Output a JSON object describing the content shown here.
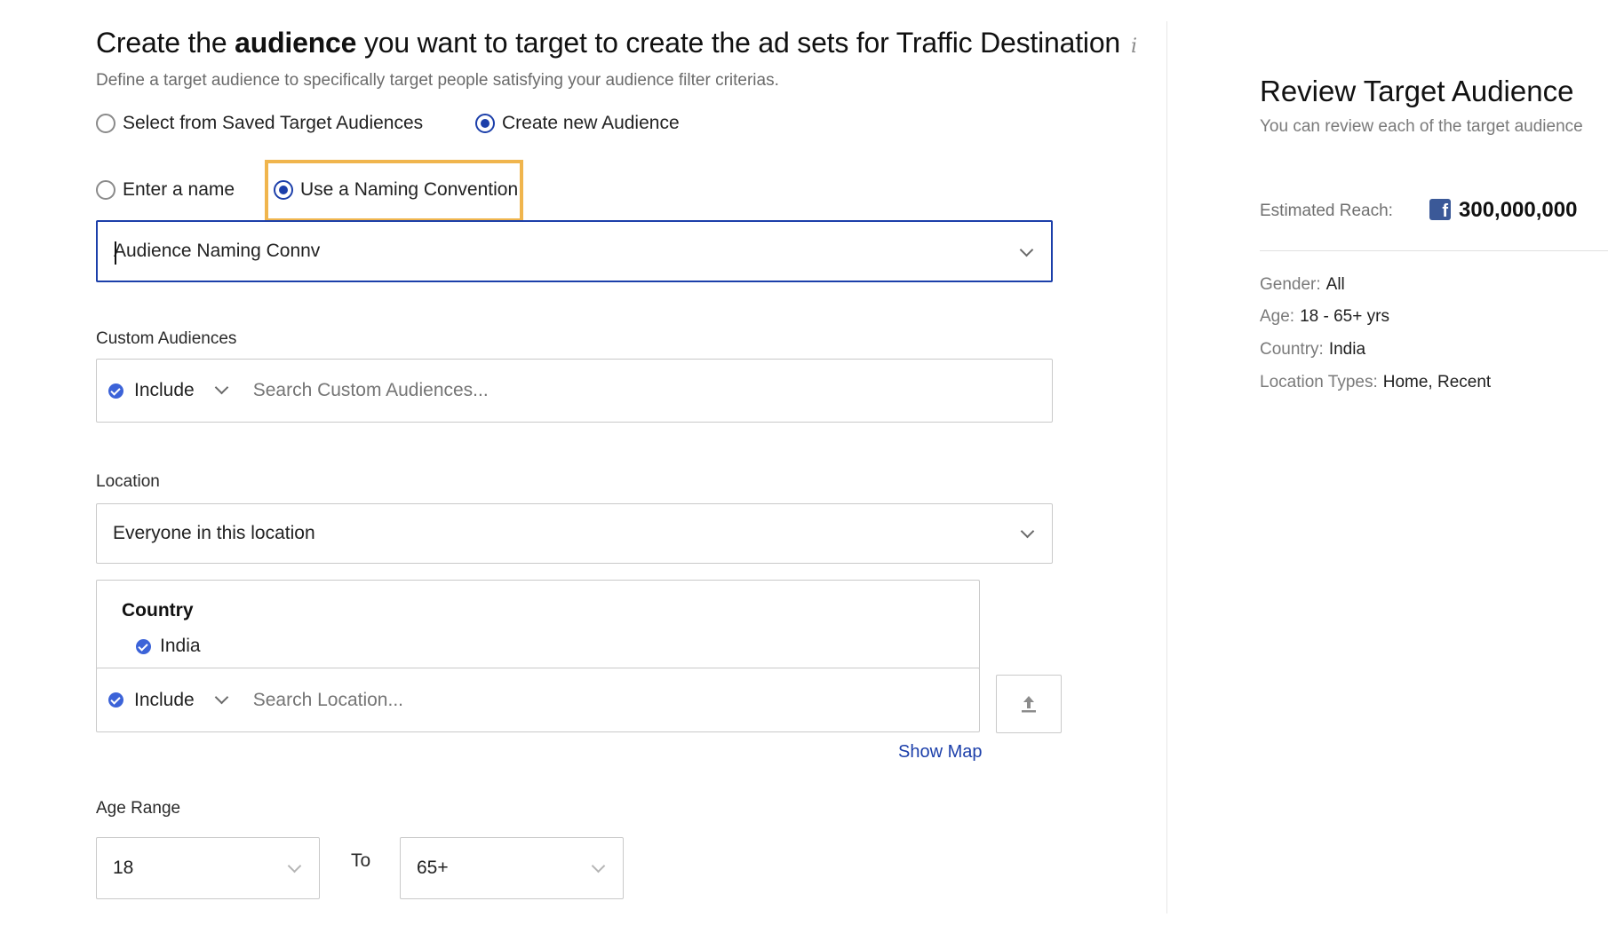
{
  "header": {
    "title_prefix": "Create the ",
    "title_bold": "audience",
    "title_suffix": " you want to target to create the ad sets for Traffic Destination",
    "info_icon": "i",
    "subtitle": "Define a target audience to specifically target people satisfying your audience filter criterias."
  },
  "audience_source": {
    "options": [
      {
        "label": "Select from Saved Target Audiences",
        "checked": false
      },
      {
        "label": "Create new Audience",
        "checked": true
      }
    ]
  },
  "naming": {
    "options": [
      {
        "label": "Enter a name",
        "checked": false
      },
      {
        "label": "Use a Naming Convention",
        "checked": true
      }
    ],
    "select_value": "Audience Naming Connv"
  },
  "custom_audiences": {
    "label": "Custom Audiences",
    "mode": "Include",
    "placeholder": "Search Custom Audiences..."
  },
  "location": {
    "label": "Location",
    "select_value": "Everyone in this location",
    "country_heading": "Country",
    "selected_country": "India",
    "mode": "Include",
    "placeholder": "Search Location...",
    "show_map": "Show Map"
  },
  "age_range": {
    "label": "Age Range",
    "from": "18",
    "to_label": "To",
    "to": "65+"
  },
  "review": {
    "title": "Review Target Audience",
    "subtitle": "You can review each of the target audience",
    "reach_label": "Estimated Reach:",
    "reach_icon": "facebook-icon",
    "reach_value": "300,000,000",
    "summary": [
      {
        "key": "Gender:",
        "value": "All"
      },
      {
        "key": "Age:",
        "value": "18 - 65+ yrs"
      },
      {
        "key": "Country:",
        "value": "India"
      },
      {
        "key": "Location Types:",
        "value": "Home, Recent"
      }
    ]
  },
  "colors": {
    "accent": "#1c3faa",
    "highlight": "#f0b54d",
    "facebook": "#3b5998"
  }
}
